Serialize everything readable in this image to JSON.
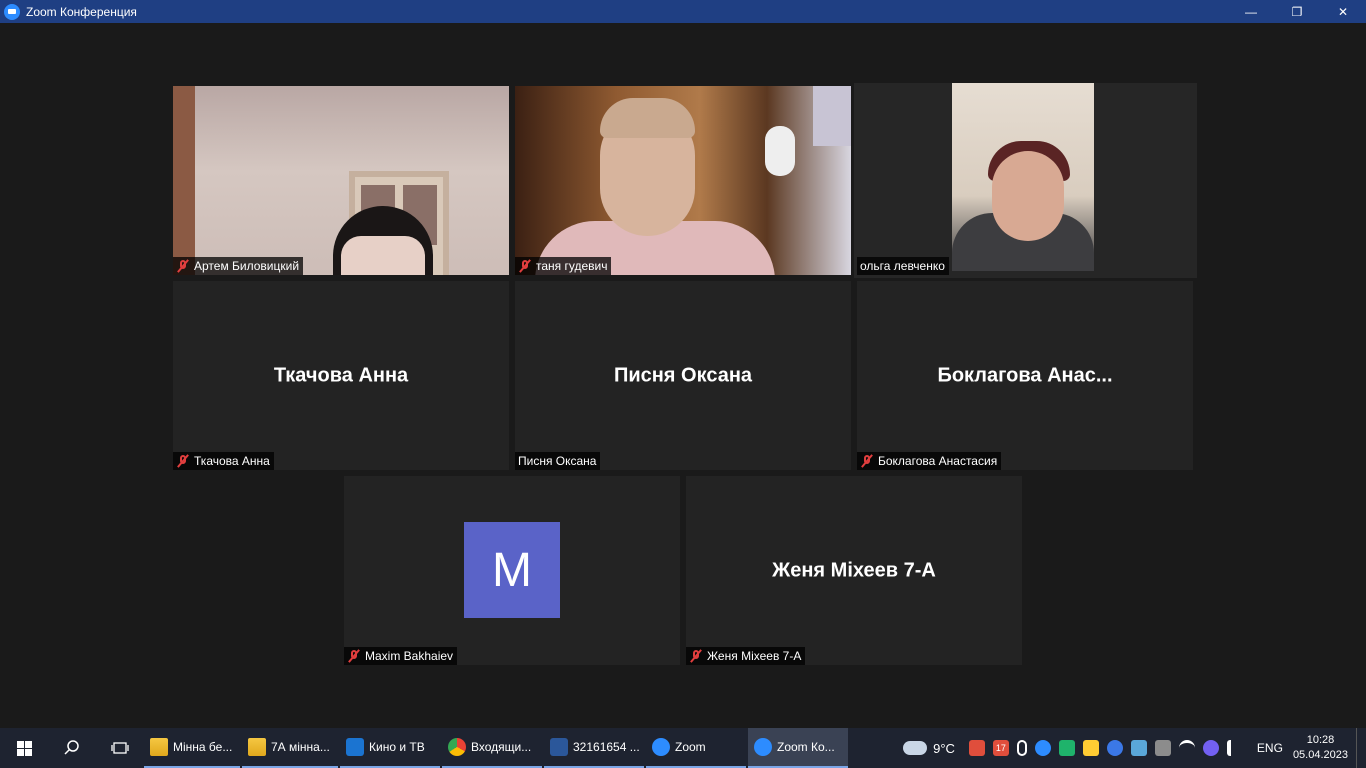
{
  "window": {
    "title": "Zoom Конференция",
    "minimize_glyph": "—",
    "restore_glyph": "❐",
    "close_glyph": "✕"
  },
  "participants": [
    {
      "name": "Артем Биловицкий",
      "muted": true,
      "video": true
    },
    {
      "name": "таня гудевич",
      "muted": true,
      "video": true
    },
    {
      "name": "ольга левченко",
      "muted": false,
      "video": true,
      "active_speaker": true
    },
    {
      "name": "Ткачова Анна",
      "display": "Ткачова Анна",
      "muted": true,
      "video": false
    },
    {
      "name": "Писня Оксана",
      "display": "Писня Оксана",
      "muted": false,
      "video": false
    },
    {
      "name": "Боклагова Анастасия",
      "display": "Боклагова  Анас...",
      "muted": true,
      "video": false
    },
    {
      "name": "Maxim Bakhaiev",
      "avatar_letter": "M",
      "muted": true,
      "video": false
    },
    {
      "name": "Женя Міхеев 7-А",
      "display": "Женя Міхеев 7-А",
      "muted": true,
      "video": false
    }
  ],
  "colors": {
    "titlebar": "#1f3f83",
    "stage": "#1a1a1a",
    "tile": "#232323",
    "active_border": "#d6e46b",
    "mute_red": "#e03e3e",
    "avatar": "#5a63c8",
    "taskbar": "#1e2330"
  },
  "taskbar": {
    "apps": [
      {
        "label": "Мінна бе...",
        "icon": "folder-icon"
      },
      {
        "label": "7А мінна...",
        "icon": "folder-icon"
      },
      {
        "label": "Кино и ТВ",
        "icon": "movies-tv-icon"
      },
      {
        "label": "Входящи...",
        "icon": "chrome-icon"
      },
      {
        "label": "32161654 ...",
        "icon": "word-icon"
      },
      {
        "label": "Zoom",
        "icon": "zoom-icon"
      },
      {
        "label": "Zoom Ко...",
        "icon": "zoom-icon",
        "active": true
      }
    ],
    "weather": "9°C",
    "language": "ENG",
    "time": "10:28",
    "date": "05.04.2023",
    "tray_badge": "17"
  }
}
